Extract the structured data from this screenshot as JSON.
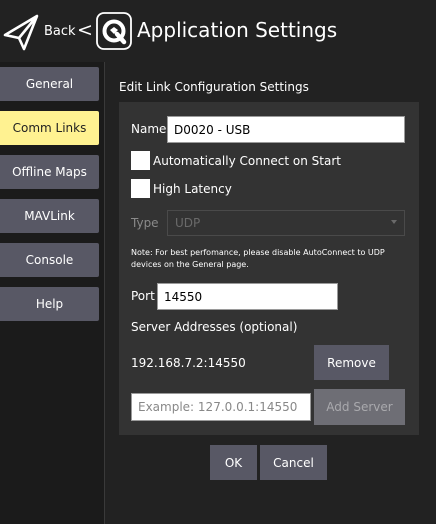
{
  "header": {
    "back_label": "Back",
    "back_glyph": "<",
    "title": "Application Settings",
    "back_icon": "paper-plane-icon",
    "logo_icon": "qgc-logo-icon"
  },
  "sidebar": {
    "items": [
      {
        "label": "General",
        "active": false
      },
      {
        "label": "Comm Links",
        "active": true
      },
      {
        "label": "Offline Maps",
        "active": false
      },
      {
        "label": "MAVLink",
        "active": false
      },
      {
        "label": "Console",
        "active": false
      },
      {
        "label": "Help",
        "active": false
      }
    ]
  },
  "form": {
    "title": "Edit Link Configuration Settings",
    "name_label": "Name",
    "name_value": "D0020 - USB",
    "auto_connect_label": "Automatically Connect on Start",
    "auto_connect_checked": false,
    "high_latency_label": "High Latency",
    "high_latency_checked": false,
    "type_label": "Type",
    "type_value": "UDP",
    "note": "Note: For best perfomance, please disable AutoConnect to UDP devices on the General page.",
    "port_label": "Port",
    "port_value": "14550",
    "server_addresses_label": "Server Addresses (optional)",
    "server_address": "192.168.7.2:14550",
    "remove_label": "Remove",
    "server_placeholder": "Example: 127.0.0.1:14550",
    "add_server_label": "Add Server"
  },
  "footer": {
    "ok_label": "OK",
    "cancel_label": "Cancel"
  },
  "colors": {
    "background": "#222222",
    "panel": "#333333",
    "button": "#585865",
    "active_nav": "#fff291"
  }
}
